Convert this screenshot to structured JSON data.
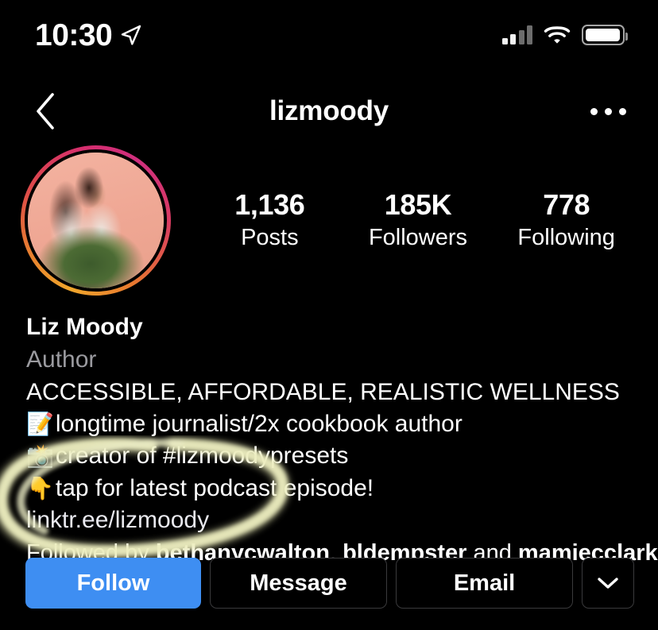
{
  "status_bar": {
    "time": "10:30",
    "location_icon": "location-arrow-icon",
    "signal_icon": "cellular-signal-icon",
    "wifi_icon": "wifi-icon",
    "battery_icon": "battery-icon",
    "battery_level_pct": 88
  },
  "nav": {
    "back_icon": "chevron-left-icon",
    "title": "lizmoody",
    "more_icon": "more-options-icon"
  },
  "profile": {
    "avatar_name": "profile-avatar",
    "has_story_ring": true,
    "ring_colors": [
      "#f0a62c",
      "#e8792f",
      "#d62e6e",
      "#cf2f7e"
    ],
    "stats": [
      {
        "value": "1,136",
        "label": "Posts"
      },
      {
        "value": "185K",
        "label": "Followers"
      },
      {
        "value": "778",
        "label": "Following"
      }
    ],
    "full_name": "Liz Moody",
    "category": "Author",
    "bio_lines": [
      {
        "emoji": "",
        "text": "ACCESSIBLE, AFFORDABLE, REALISTIC WELLNESS"
      },
      {
        "emoji": "📝",
        "text": "longtime journalist/2x cookbook author"
      },
      {
        "emoji": "📸",
        "text": "creator of #lizmoodypresets"
      },
      {
        "emoji": "👇",
        "text": "tap for latest podcast episode!"
      }
    ],
    "link": "linktr.ee/lizmoody",
    "followed_by": {
      "prefix": "Followed by ",
      "name1": "bethanycwalton",
      "sep1": ", ",
      "name2": "bldempster",
      "sep2": " and ",
      "name3": "mamiecclark"
    }
  },
  "actions": {
    "follow_label": "Follow",
    "message_label": "Message",
    "email_label": "Email",
    "dropdown_icon": "chevron-down-icon",
    "follow_color": "#3e8ef2"
  },
  "annotation": {
    "shape": "hand-drawn-oval-highlight",
    "color": "#e9e9b8"
  }
}
